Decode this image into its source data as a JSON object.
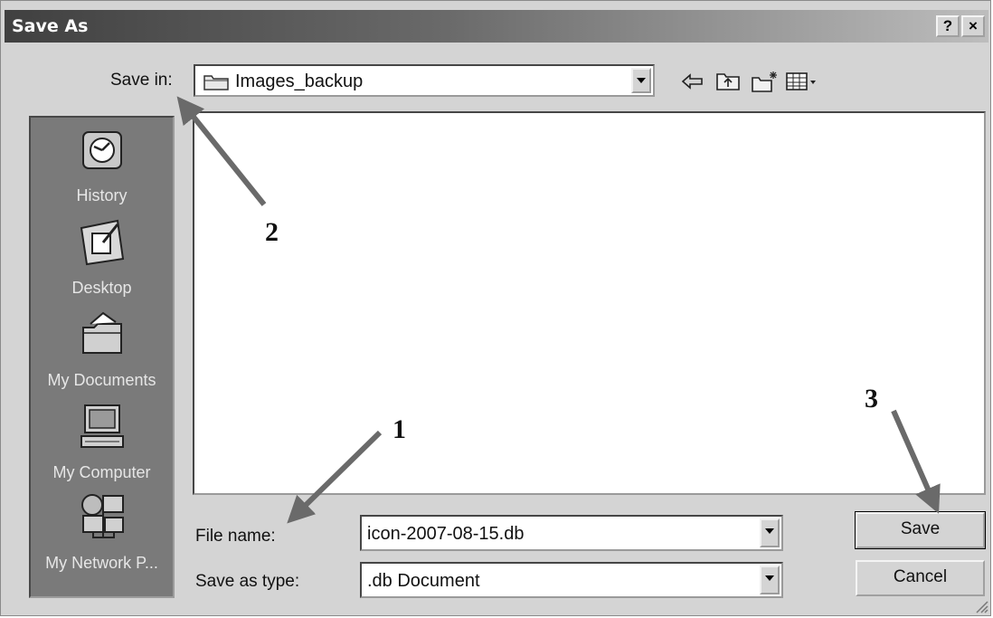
{
  "window": {
    "title": "Save As",
    "help_label": "?",
    "close_label": "×"
  },
  "toolbar": {
    "save_in_label": "Save in:",
    "save_in_value": "Images_backup",
    "icons": [
      "back-icon",
      "up-folder-icon",
      "new-folder-icon",
      "views-menu-icon"
    ]
  },
  "places": [
    {
      "label": "History",
      "icon": "history-icon"
    },
    {
      "label": "Desktop",
      "icon": "desktop-icon"
    },
    {
      "label": "My Documents",
      "icon": "my-documents-icon"
    },
    {
      "label": "My Computer",
      "icon": "my-computer-icon"
    },
    {
      "label": "My Network P...",
      "icon": "network-places-icon"
    }
  ],
  "form": {
    "file_name_label": "File name:",
    "file_name_value": "icon-2007-08-15.db",
    "save_as_type_label": "Save as type:",
    "save_as_type_value": ".db Document"
  },
  "buttons": {
    "save": "Save",
    "cancel": "Cancel"
  },
  "annotations": {
    "callout_1": "1",
    "callout_2": "2",
    "callout_3": "3"
  }
}
